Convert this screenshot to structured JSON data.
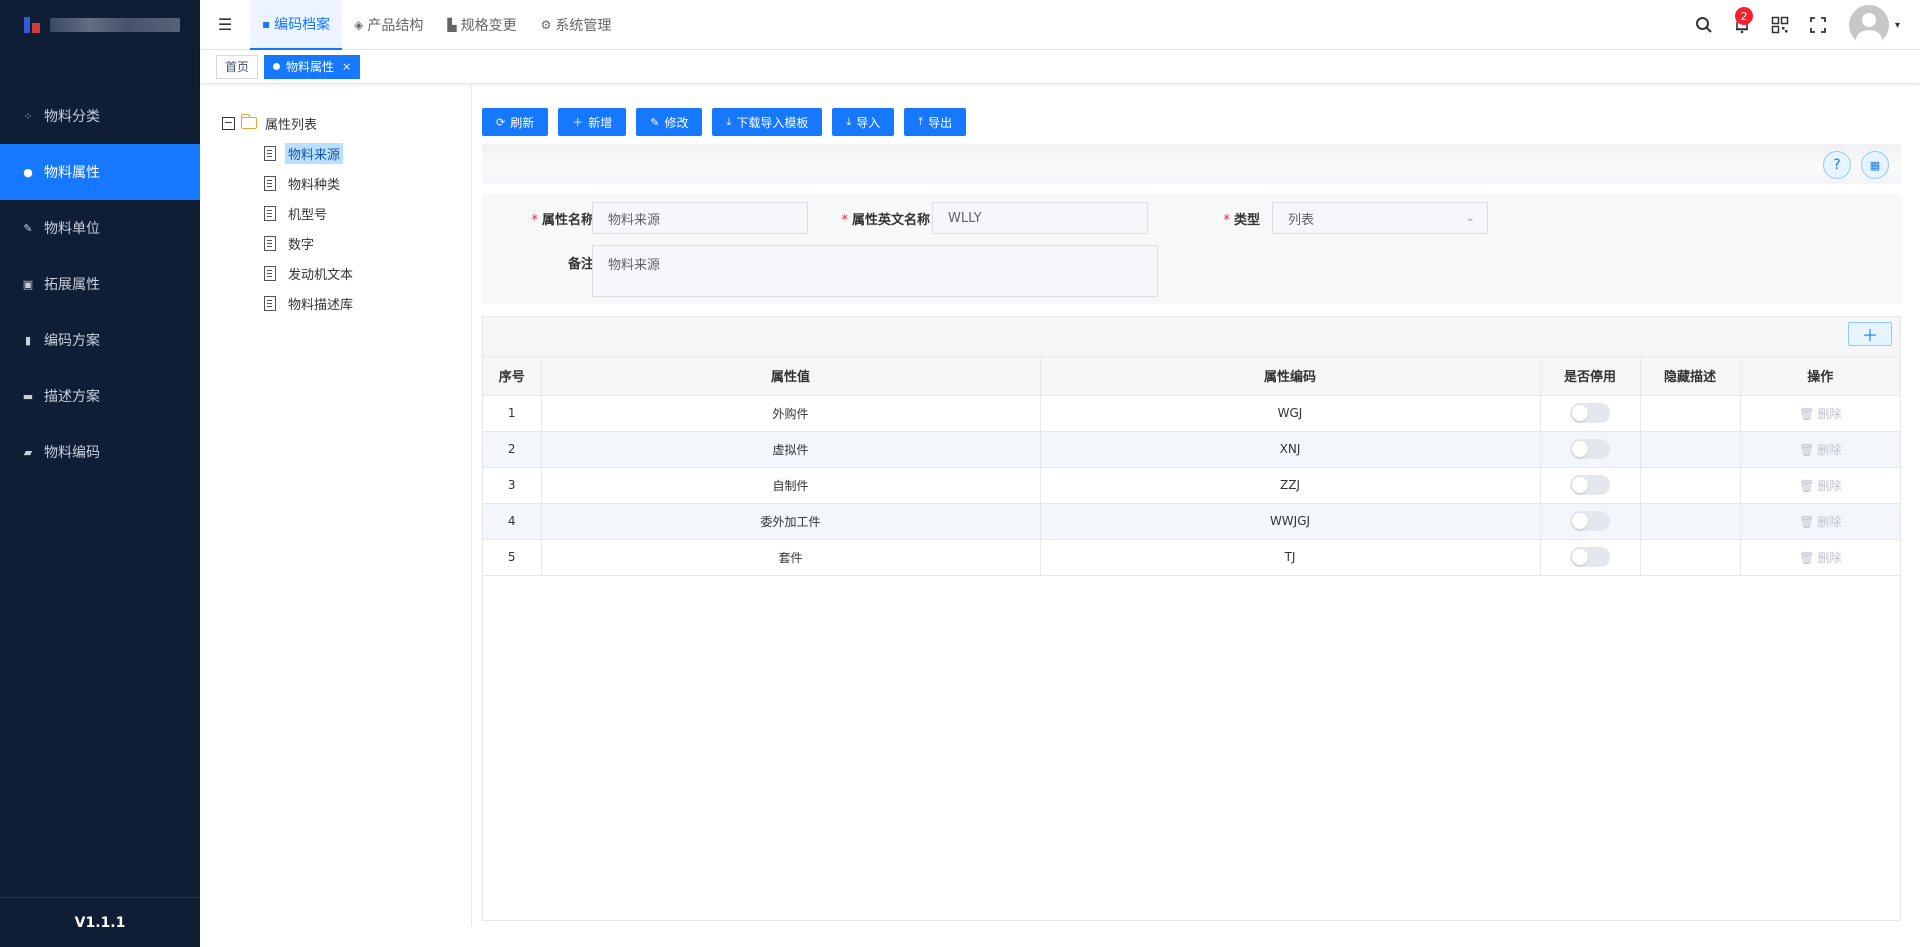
{
  "sidebar": {
    "menu": [
      {
        "label": "物料分类",
        "icon": "grid-icon",
        "glyph": "⁘",
        "active": false
      },
      {
        "label": "物料属性",
        "icon": "info-icon",
        "glyph": "●",
        "active": true
      },
      {
        "label": "物料单位",
        "icon": "wrench-icon",
        "glyph": "✎",
        "active": false
      },
      {
        "label": "拓展属性",
        "icon": "extend-icon",
        "glyph": "▣",
        "active": false
      },
      {
        "label": "编码方案",
        "icon": "book-icon",
        "glyph": "▮",
        "active": false
      },
      {
        "label": "描述方案",
        "icon": "doc-icon",
        "glyph": "▬",
        "active": false
      },
      {
        "label": "物料编码",
        "icon": "code-icon",
        "glyph": "▰",
        "active": false
      }
    ],
    "version": "V1.1.1"
  },
  "header": {
    "tabs": [
      {
        "label": "编码档案",
        "icon": "folder-icon",
        "glyph": "▪",
        "active": true
      },
      {
        "label": "产品结构",
        "icon": "layers-icon",
        "glyph": "◈",
        "active": false
      },
      {
        "label": "规格变更",
        "icon": "chart-icon",
        "glyph": "▙",
        "active": false
      },
      {
        "label": "系统管理",
        "icon": "gear-icon",
        "glyph": "⚙",
        "active": false
      }
    ],
    "notification_count": "2"
  },
  "tagbar": {
    "home": "首页",
    "current": "物料属性",
    "close": "×"
  },
  "tree": {
    "root": "属性列表",
    "toggle": "−",
    "children": [
      "物料来源",
      "物料种类",
      "机型号",
      "数字",
      "发动机文本",
      "物料描述库"
    ],
    "selected_index": 0
  },
  "toolbar": {
    "refresh": "刷新",
    "add": "新增",
    "edit": "修改",
    "download_template": "下载导入模板",
    "import": "导入",
    "export": "导出"
  },
  "form": {
    "name_label": "属性名称",
    "name_value": "物料来源",
    "en_name_label": "属性英文名称",
    "en_name_value": "WLLY",
    "type_label": "类型",
    "type_value": "列表",
    "remark_label": "备注",
    "remark_value": "物料来源"
  },
  "table": {
    "headers": [
      "序号",
      "属性值",
      "属性编码",
      "是否停用",
      "隐藏描述",
      "操作"
    ],
    "delete_label": "删除",
    "rows": [
      {
        "no": "1",
        "value": "外购件",
        "code": "WGJ",
        "disabled": false,
        "hide_desc": ""
      },
      {
        "no": "2",
        "value": "虚拟件",
        "code": "XNJ",
        "disabled": false,
        "hide_desc": ""
      },
      {
        "no": "3",
        "value": "自制件",
        "code": "ZZJ",
        "disabled": false,
        "hide_desc": ""
      },
      {
        "no": "4",
        "value": "委外加工件",
        "code": "WWJGJ",
        "disabled": false,
        "hide_desc": ""
      },
      {
        "no": "5",
        "value": "套件",
        "code": "TJ",
        "disabled": false,
        "hide_desc": ""
      }
    ]
  }
}
